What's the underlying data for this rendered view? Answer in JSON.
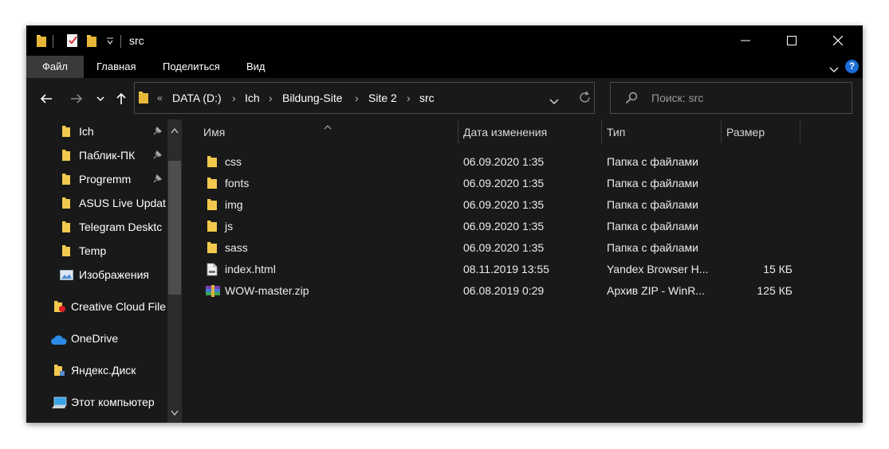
{
  "window": {
    "title": "src"
  },
  "ribbon": {
    "tabs": [
      {
        "label": "Файл",
        "active": true
      },
      {
        "label": "Главная",
        "active": false
      },
      {
        "label": "Поделиться",
        "active": false
      },
      {
        "label": "Вид",
        "active": false
      }
    ],
    "help_label": "?"
  },
  "address": {
    "overflow": "«",
    "crumbs": [
      "DATA (D:)",
      "Ich",
      "Bildung-Site",
      "Site 2",
      "src"
    ],
    "separator": "›"
  },
  "search": {
    "placeholder": "Поиск: src"
  },
  "sidebar": {
    "items": [
      {
        "label": "Ich",
        "icon": "folder-icon",
        "pinned": true
      },
      {
        "label": "Паблик-ПК",
        "icon": "folder-icon",
        "pinned": true
      },
      {
        "label": "Progremm",
        "icon": "folder-icon",
        "pinned": true
      },
      {
        "label": "ASUS Live Updat",
        "icon": "folder-icon",
        "pinned": false
      },
      {
        "label": "Telegram Desktc",
        "icon": "folder-icon",
        "pinned": false
      },
      {
        "label": "Temp",
        "icon": "folder-icon",
        "pinned": false
      },
      {
        "label": "Изображения",
        "icon": "pictures-icon",
        "pinned": false
      },
      {
        "label": "Creative Cloud File",
        "icon": "creative-cloud-folder-icon",
        "pinned": false
      },
      {
        "label": "OneDrive",
        "icon": "onedrive-cloud-icon",
        "pinned": false
      },
      {
        "label": "Яндекс.Диск",
        "icon": "yandex-disk-folder-icon",
        "pinned": false
      },
      {
        "label": "Этот компьютер",
        "icon": "computer-icon",
        "pinned": false
      }
    ]
  },
  "columns": {
    "name": "Имя",
    "modified": "Дата изменения",
    "type": "Тип",
    "size": "Размер"
  },
  "files": [
    {
      "name": "css",
      "modified": "06.09.2020 1:35",
      "type": "Папка с файлами",
      "size": "",
      "icon": "folder-icon"
    },
    {
      "name": "fonts",
      "modified": "06.09.2020 1:35",
      "type": "Папка с файлами",
      "size": "",
      "icon": "folder-icon"
    },
    {
      "name": "img",
      "modified": "06.09.2020 1:35",
      "type": "Папка с файлами",
      "size": "",
      "icon": "folder-icon"
    },
    {
      "name": "js",
      "modified": "06.09.2020 1:35",
      "type": "Папка с файлами",
      "size": "",
      "icon": "folder-icon"
    },
    {
      "name": "sass",
      "modified": "06.09.2020 1:35",
      "type": "Папка с файлами",
      "size": "",
      "icon": "folder-icon"
    },
    {
      "name": "index.html",
      "modified": "08.11.2019 13:55",
      "type": "Yandex Browser H...",
      "size": "15 КБ",
      "icon": "html-file-icon"
    },
    {
      "name": "WOW-master.zip",
      "modified": "06.08.2019 0:29",
      "type": "Архив ZIP - WinR...",
      "size": "125 КБ",
      "icon": "winrar-archive-icon"
    }
  ],
  "colors": {
    "background": "#191919",
    "titlebar": "#000000",
    "folder_yellow": "#f2c94c",
    "accent_blue": "#1a6cd6"
  }
}
